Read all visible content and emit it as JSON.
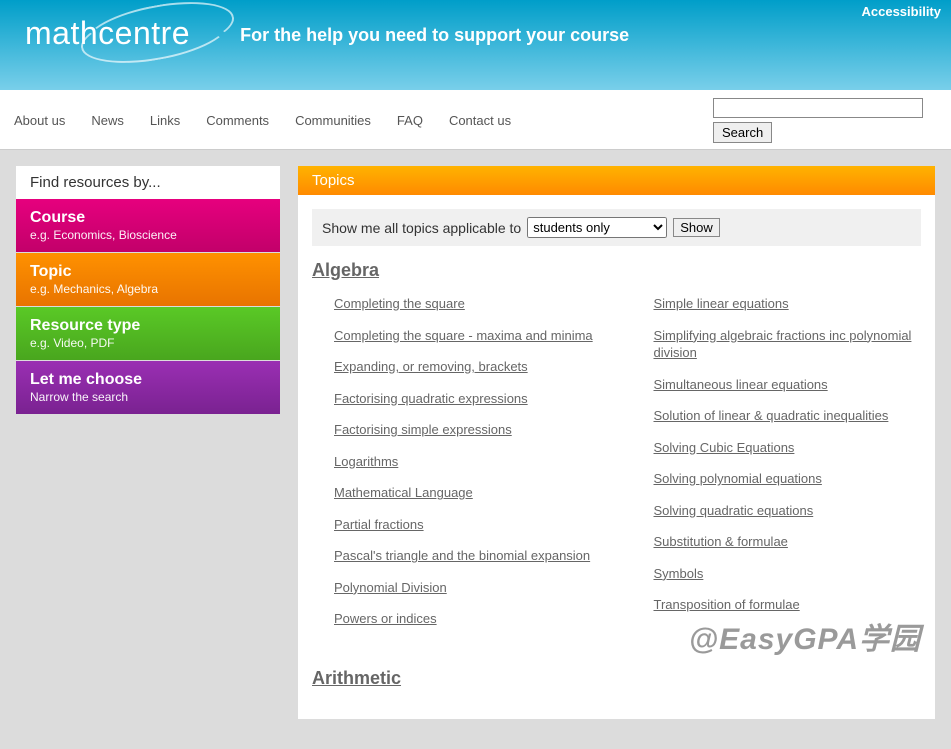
{
  "header": {
    "accessibility_label": "Accessibility",
    "logo_text": "mathcentre",
    "tagline": "For the help you need to support your course"
  },
  "nav": {
    "items": [
      "About us",
      "News",
      "Links",
      "Comments",
      "Communities",
      "FAQ",
      "Contact us"
    ],
    "search_button": "Search"
  },
  "sidebar": {
    "title": "Find resources by...",
    "items": [
      {
        "title": "Course",
        "subtitle": "e.g. Economics, Bioscience"
      },
      {
        "title": "Topic",
        "subtitle": "e.g. Mechanics, Algebra"
      },
      {
        "title": "Resource type",
        "subtitle": "e.g. Video, PDF"
      },
      {
        "title": "Let me choose",
        "subtitle": "Narrow the search"
      }
    ]
  },
  "main": {
    "header": "Topics",
    "filter_label": "Show me all topics applicable to",
    "filter_selected": "students only",
    "filter_button": "Show",
    "sections": [
      {
        "title": "Algebra",
        "col1": [
          "Completing the square",
          "Completing the square - maxima and minima",
          "Expanding, or removing, brackets",
          "Factorising quadratic expressions",
          "Factorising simple expressions",
          "Logarithms",
          "Mathematical Language",
          "Partial fractions",
          "Pascal's triangle and the binomial expansion",
          "Polynomial Division",
          "Powers or indices"
        ],
        "col2": [
          "Simple linear equations",
          "Simplifying algebraic fractions inc polynomial division",
          "Simultaneous linear equations",
          "Solution of linear & quadratic inequalities",
          "Solving Cubic Equations",
          "Solving polynomial equations",
          "Solving quadratic equations",
          "Substitution & formulae",
          "Symbols",
          "Transposition of formulae"
        ]
      },
      {
        "title": "Arithmetic",
        "col1": [],
        "col2": []
      }
    ]
  },
  "watermark": "@EasyGPA学园"
}
